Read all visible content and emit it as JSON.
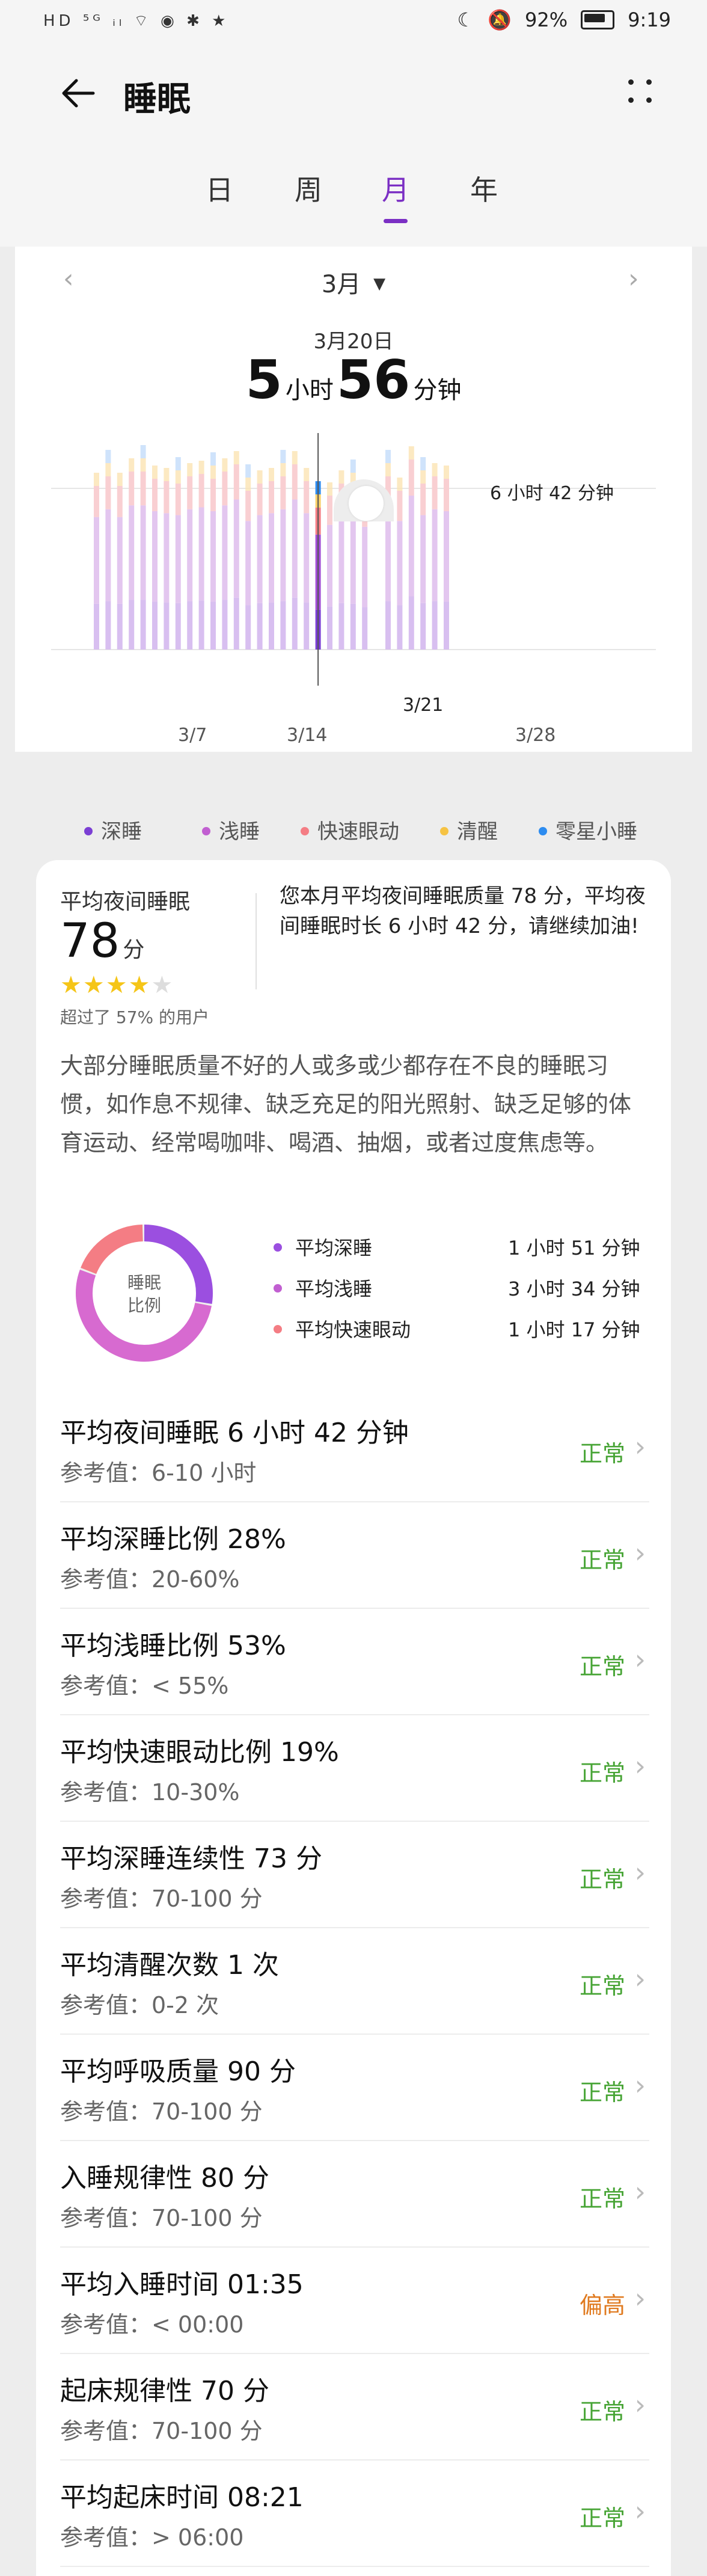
{
  "status_bar": {
    "left_icons": "HD ⁵ᴳ ᵢₗ ⌔ ◉ ✱ ★",
    "battery": "92%",
    "time": "9:19"
  },
  "header": {
    "title": "睡眠",
    "tabs": [
      {
        "label": "日",
        "active": false
      },
      {
        "label": "周",
        "active": false
      },
      {
        "label": "月",
        "active": true
      },
      {
        "label": "年",
        "active": false
      }
    ]
  },
  "chart_card": {
    "month_selector": "3月",
    "selected_date": "3月20日",
    "hours": "5",
    "hours_unit": "小时",
    "minutes": "56",
    "minutes_unit": "分钟",
    "average_line_label": "6 小时 42 分钟",
    "selected_tick": "3/21"
  },
  "chart_data": {
    "type": "bar",
    "stacked": true,
    "x_tick_labels": [
      "3/7",
      "3/14",
      "3/21",
      "3/28"
    ],
    "average_line_label": "6 小时 42 分钟",
    "selected_day": 20,
    "series": [
      {
        "name": "深睡",
        "color": "#7b3fd4"
      },
      {
        "name": "浅睡",
        "color": "#c15fd1"
      },
      {
        "name": "快速眼动",
        "color": "#f47d84"
      },
      {
        "name": "清醒",
        "color": "#f6c343"
      },
      {
        "name": "零星小睡",
        "color": "#2d8cf0"
      }
    ],
    "days": [
      1,
      2,
      3,
      4,
      5,
      6,
      7,
      8,
      9,
      10,
      11,
      12,
      13,
      14,
      15,
      16,
      17,
      18,
      19,
      20,
      21,
      22,
      23,
      24,
      25,
      26,
      27,
      28,
      29,
      30,
      31
    ],
    "total_hours": [
      6.8,
      7.2,
      6.8,
      7.4,
      7.4,
      7.1,
      7.0,
      6.9,
      7.2,
      7.3,
      7.1,
      7.4,
      7.7,
      6.6,
      6.9,
      7.0,
      7.2,
      7.7,
      7.0,
      5.9,
      6.4,
      6.9,
      6.8,
      6.3,
      null,
      7.2,
      6.6,
      7.9,
      6.9,
      7.2,
      7.1
    ],
    "light_fraction": [
      0.53,
      0.53,
      0.53,
      0.53,
      0.53,
      0.53,
      0.53,
      0.53,
      0.53,
      0.53,
      0.53,
      0.53,
      0.53,
      0.53,
      0.53,
      0.53,
      0.53,
      0.53,
      0.53,
      0.53,
      0.53,
      0.53,
      0.53,
      0.53,
      null,
      0.53,
      0.53,
      0.53,
      0.53,
      0.53,
      0.53
    ]
  },
  "legend": [
    {
      "label": "深睡",
      "color": "#7b3fd4"
    },
    {
      "label": "浅睡",
      "color": "#c15fd1"
    },
    {
      "label": "快速眼动",
      "color": "#f47d84"
    },
    {
      "label": "清醒",
      "color": "#f6c343"
    },
    {
      "label": "零星小睡",
      "color": "#2d8cf0"
    }
  ],
  "summary": {
    "label": "平均夜间睡眠",
    "score": "78",
    "score_unit": "分",
    "stars": 4,
    "stars_max": 5,
    "beat_text": "超过了 57% 的用户",
    "description": "您本月平均夜间睡眠质量 78 分，平均夜间睡眠时长 6 小时 42 分，请继续加油!",
    "paragraph": "大部分睡眠质量不好的人或多或少都存在不良的睡眠习惯，如作息不规律、缺乏充足的阳光照射、缺乏足够的体育运动、经常喝咖啡、喝酒、抽烟，或者过度焦虑等。"
  },
  "ratio": {
    "center_line1": "睡眠",
    "center_line2": "比例",
    "deep_fraction": 0.28,
    "light_fraction": 0.53,
    "rem_fraction": 0.19,
    "rows": [
      {
        "label": "平均深睡",
        "value": "1 小时 51 分钟",
        "color": "#9b4fe0"
      },
      {
        "label": "平均浅睡",
        "value": "3 小时 34 分钟",
        "color": "#c15fd1"
      },
      {
        "label": "平均快速眼动",
        "value": "1 小时 17 分钟",
        "color": "#f47d84"
      }
    ]
  },
  "metrics": [
    {
      "title": "平均夜间睡眠  6 小时 42 分钟",
      "ref": "参考值：6-10 小时",
      "status": "正常",
      "warn": false
    },
    {
      "title": "平均深睡比例  28%",
      "ref": "参考值：20-60%",
      "status": "正常",
      "warn": false
    },
    {
      "title": "平均浅睡比例  53%",
      "ref": "参考值：< 55%",
      "status": "正常",
      "warn": false
    },
    {
      "title": "平均快速眼动比例  19%",
      "ref": "参考值：10-30%",
      "status": "正常",
      "warn": false
    },
    {
      "title": "平均深睡连续性  73 分",
      "ref": "参考值：70-100 分",
      "status": "正常",
      "warn": false
    },
    {
      "title": "平均清醒次数  1 次",
      "ref": "参考值：0-2 次",
      "status": "正常",
      "warn": false
    },
    {
      "title": "平均呼吸质量  90 分",
      "ref": "参考值：70-100 分",
      "status": "正常",
      "warn": false
    },
    {
      "title": "入睡规律性  80 分",
      "ref": "参考值：70-100 分",
      "status": "正常",
      "warn": false
    },
    {
      "title": "平均入睡时间  01:35",
      "ref": "参考值：< 00:00",
      "status": "偏高",
      "warn": true
    },
    {
      "title": "起床规律性  70 分",
      "ref": "参考值：70-100 分",
      "status": "正常",
      "warn": false
    },
    {
      "title": "平均起床时间  08:21",
      "ref": "参考值：> 06:00",
      "status": "正常",
      "warn": false
    }
  ]
}
